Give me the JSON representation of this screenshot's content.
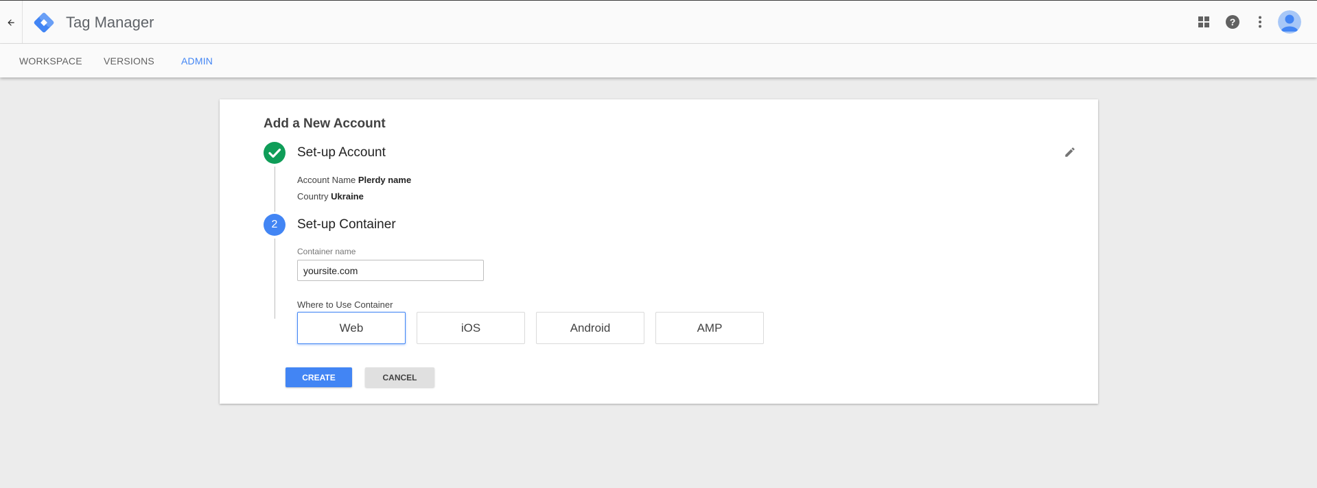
{
  "app": {
    "title": "Tag Manager"
  },
  "nav": {
    "tabs": [
      {
        "label": "WORKSPACE",
        "active": false
      },
      {
        "label": "VERSIONS",
        "active": false
      },
      {
        "label": "ADMIN",
        "active": true
      }
    ]
  },
  "icons": {
    "back": "arrow-back-icon",
    "apps": "apps-grid-icon",
    "help": "help-icon",
    "more": "more-vert-icon",
    "edit": "pencil-icon",
    "check": "check-icon"
  },
  "card": {
    "title": "Add a New Account",
    "step1": {
      "title": "Set-up Account",
      "account_name_label": "Account Name",
      "account_name_value": "Plerdy name",
      "country_label": "Country",
      "country_value": "Ukraine"
    },
    "step2": {
      "number": "2",
      "title": "Set-up Container",
      "container_name_label": "Container name",
      "container_name_value": "yoursite.com",
      "where_label": "Where to Use Container",
      "platforms": [
        "Web",
        "iOS",
        "Android",
        "AMP"
      ],
      "selected_platform": "Web"
    },
    "create_label": "CREATE",
    "cancel_label": "CANCEL"
  },
  "colors": {
    "accent": "#4285f4",
    "success": "#0f9d58",
    "background": "#ececec"
  }
}
